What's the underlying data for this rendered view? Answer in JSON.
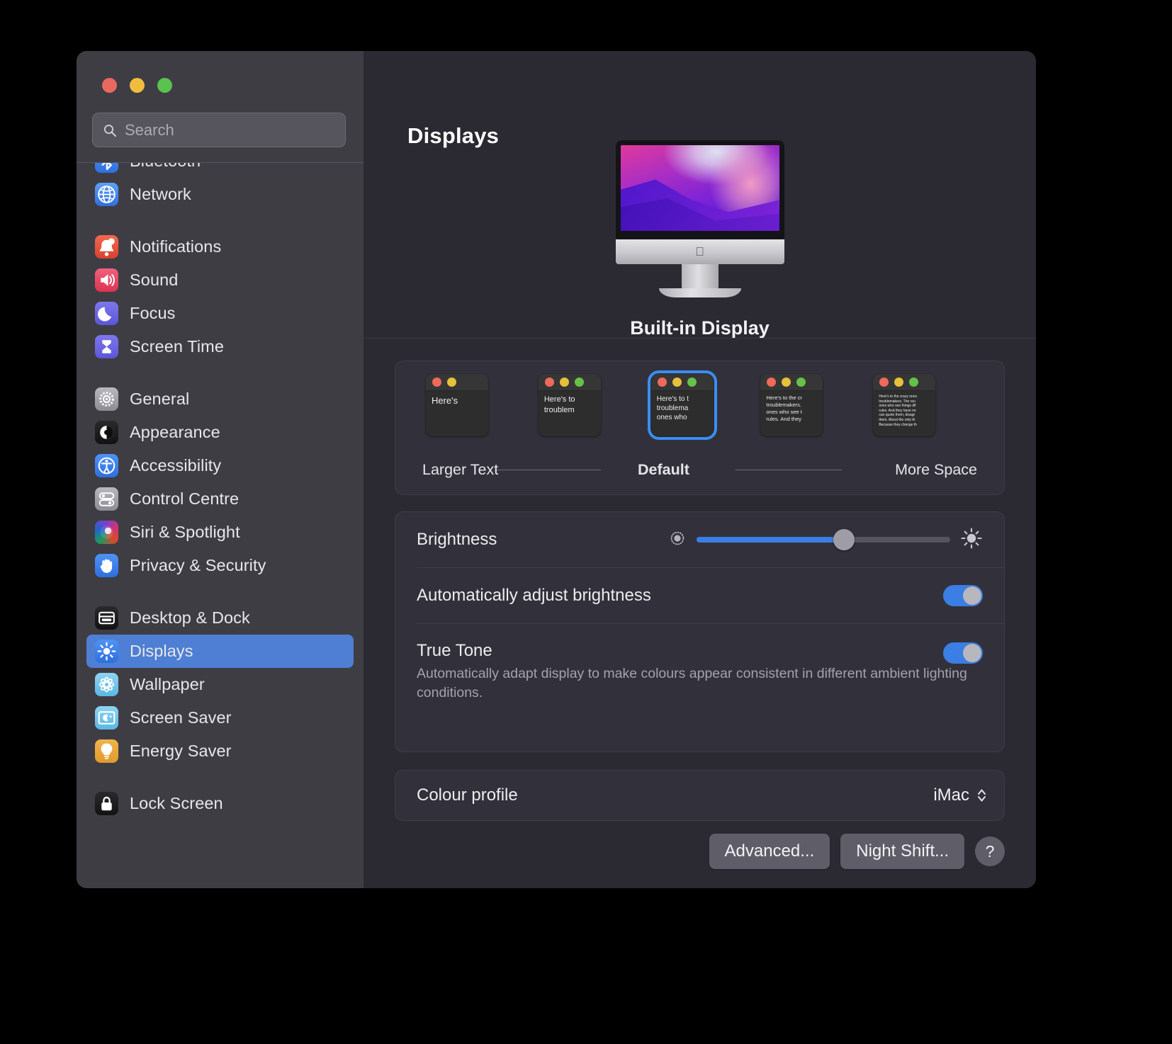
{
  "window": {
    "traffic_lights": [
      "close",
      "minimize",
      "zoom"
    ]
  },
  "search": {
    "placeholder": "Search",
    "value": ""
  },
  "sidebar": {
    "groups": [
      {
        "items": [
          {
            "label": "Bluetooth",
            "icon": "bluetooth-icon",
            "selected": false,
            "partial": true
          },
          {
            "label": "Network",
            "icon": "network-globe-icon",
            "selected": false
          }
        ]
      },
      {
        "items": [
          {
            "label": "Notifications",
            "icon": "notifications-bell-icon",
            "selected": false
          },
          {
            "label": "Sound",
            "icon": "sound-speaker-icon",
            "selected": false
          },
          {
            "label": "Focus",
            "icon": "focus-moon-icon",
            "selected": false
          },
          {
            "label": "Screen Time",
            "icon": "screen-time-hourglass-icon",
            "selected": false
          }
        ]
      },
      {
        "items": [
          {
            "label": "General",
            "icon": "general-gear-icon",
            "selected": false
          },
          {
            "label": "Appearance",
            "icon": "appearance-contrast-icon",
            "selected": false
          },
          {
            "label": "Accessibility",
            "icon": "accessibility-icon",
            "selected": false
          },
          {
            "label": "Control Centre",
            "icon": "control-centre-sliders-icon",
            "selected": false
          },
          {
            "label": "Siri & Spotlight",
            "icon": "siri-orb-icon",
            "selected": false
          },
          {
            "label": "Privacy & Security",
            "icon": "privacy-hand-icon",
            "selected": false
          }
        ]
      },
      {
        "items": [
          {
            "label": "Desktop & Dock",
            "icon": "desktop-dock-icon",
            "selected": false
          },
          {
            "label": "Displays",
            "icon": "displays-brightness-icon",
            "selected": true
          },
          {
            "label": "Wallpaper",
            "icon": "wallpaper-flower-icon",
            "selected": false
          },
          {
            "label": "Screen Saver",
            "icon": "screen-saver-icon",
            "selected": false
          },
          {
            "label": "Energy Saver",
            "icon": "energy-saver-bulb-icon",
            "selected": false
          }
        ]
      },
      {
        "items": [
          {
            "label": "Lock Screen",
            "icon": "lock-screen-icon",
            "selected": false
          }
        ]
      }
    ]
  },
  "main": {
    "title": "Displays",
    "display_name": "Built-in Display",
    "text_size": {
      "selected_index": 2,
      "left_label": "Larger Text",
      "center_label": "Default",
      "right_label": "More Space",
      "thumbs": [
        {
          "dots": 2,
          "font_size": 13,
          "lines": [
            "Here's"
          ]
        },
        {
          "dots": 3,
          "font_size": 11,
          "lines": [
            "Here's to",
            "troublem"
          ]
        },
        {
          "dots": 3,
          "font_size": 10,
          "lines": [
            "Here's to t",
            "troublema",
            "ones who"
          ]
        },
        {
          "dots": 3,
          "font_size": 7.5,
          "lines": [
            "Here's to the cr",
            "troublemakers.",
            "ones who see t",
            "rules. And they"
          ]
        },
        {
          "dots": 3,
          "font_size": 5,
          "lines": [
            "Here's to the crazy ones",
            "troublemakers. The rou",
            "ones who see things dif",
            "rules. And they have no",
            "can quote them, disagr",
            "them. About the only th",
            "Because they change th"
          ]
        }
      ]
    },
    "brightness": {
      "label": "Brightness",
      "value_percent": 58
    },
    "auto_brightness": {
      "label": "Automatically adjust brightness",
      "enabled": true
    },
    "true_tone": {
      "label": "True Tone",
      "description": "Automatically adapt display to make colours appear consistent in different ambient lighting conditions.",
      "enabled": true
    },
    "colour_profile": {
      "label": "Colour profile",
      "value": "iMac"
    },
    "buttons": {
      "advanced": "Advanced...",
      "night_shift": "Night Shift...",
      "help": "?"
    }
  },
  "colors": {
    "accent": "#3b7ee4",
    "sidebar_selected": "#4e7fd4",
    "sidebar_bg": "#3f3d44",
    "content_bg": "#2b2a33",
    "panel_bg": "#32313b"
  }
}
